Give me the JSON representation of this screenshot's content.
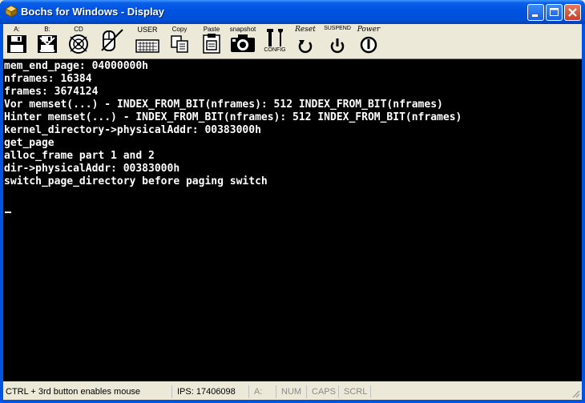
{
  "window": {
    "title": "Bochs for Windows - Display",
    "controls": {
      "minimize": "minimize",
      "maximize": "maximize",
      "close": "close"
    }
  },
  "toolbar": {
    "floppy_a": "A:",
    "floppy_b": "B:",
    "cdrom": "CD",
    "user": "USER",
    "copy": "Copy",
    "paste": "Paste",
    "snapshot": "snapshot",
    "config": "CONFIG",
    "reset": "Reset",
    "suspend": "SUSPEND",
    "power": "Power"
  },
  "console": {
    "lines": [
      "mem_end_page: 04000000h",
      "nframes: 16384",
      "frames: 3674124",
      "Vor memset(...) - INDEX_FROM_BIT(nframes): 512 INDEX_FROM_BIT(nframes)",
      "Hinter memset(...) - INDEX_FROM_BIT(nframes): 512 INDEX_FROM_BIT(nframes)",
      "kernel_directory->physicalAddr: 00383000h",
      "get_page",
      "alloc_frame part 1 and 2",
      "dir->physicalAddr: 00383000h",
      "switch_page_directory before paging switch"
    ]
  },
  "statusbar": {
    "message": "CTRL + 3rd button enables mouse",
    "ips": "IPS:  17406098",
    "drive": "A:",
    "num": "NUM",
    "caps": "CAPS",
    "scrl": "SCRL"
  },
  "colors": {
    "titlebar": "#0054e3",
    "console_bg": "#000000",
    "console_fg": "#ffffff",
    "chrome": "#ece9d8"
  }
}
